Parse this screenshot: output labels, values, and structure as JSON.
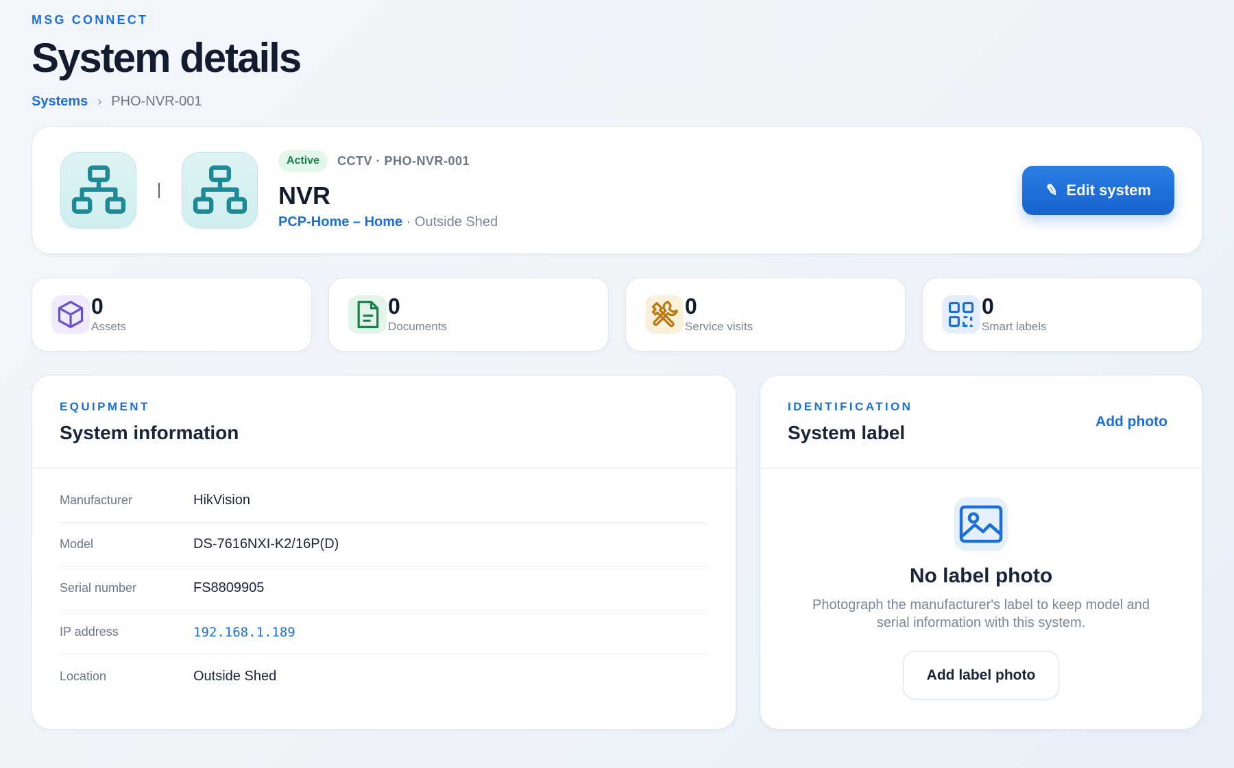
{
  "app": {
    "brand": "MSG CONNECT",
    "page_title": "System details"
  },
  "breadcrumb": {
    "root": "Systems",
    "separator": "›",
    "current": "PHO-NVR-001"
  },
  "system": {
    "status": "Active",
    "meta": "CCTV · PHO-NVR-001",
    "name": "NVR",
    "site": "PCP-Home – Home",
    "location_suffix": " · Outside Shed",
    "icon": "network-tree-icon",
    "edit_label": "Edit system"
  },
  "stats": [
    {
      "value": "0",
      "label": "Assets",
      "icon": "cube-icon",
      "color": "#6b4fc9"
    },
    {
      "value": "0",
      "label": "Documents",
      "icon": "document-icon",
      "color": "#1a7f4a"
    },
    {
      "value": "0",
      "label": "Service visits",
      "icon": "tools-icon",
      "color": "#b9770e"
    },
    {
      "value": "0",
      "label": "Smart labels",
      "icon": "qr-code-icon",
      "color": "#1c6fd6"
    }
  ],
  "equipment": {
    "kicker": "EQUIPMENT",
    "title": "System information",
    "rows": [
      {
        "key": "Manufacturer",
        "value": "HikVision"
      },
      {
        "key": "Model",
        "value": "DS-7616NXI-K2/16P(D)"
      },
      {
        "key": "Serial number",
        "value": "FS8809905"
      },
      {
        "key": "IP address",
        "value": "192.168.1.189"
      },
      {
        "key": "Location",
        "value": "Outside Shed"
      }
    ]
  },
  "identification": {
    "kicker": "IDENTIFICATION",
    "title": "System label",
    "add_photo": "Add photo",
    "empty_title": "No label photo",
    "empty_desc": "Photograph the manufacturer's label to keep model and serial information with this system.",
    "add_label_button": "Add label photo"
  },
  "colors": {
    "accent": "#1c6fd6",
    "teal": "#1b8a94",
    "active_green": "#16804a"
  }
}
